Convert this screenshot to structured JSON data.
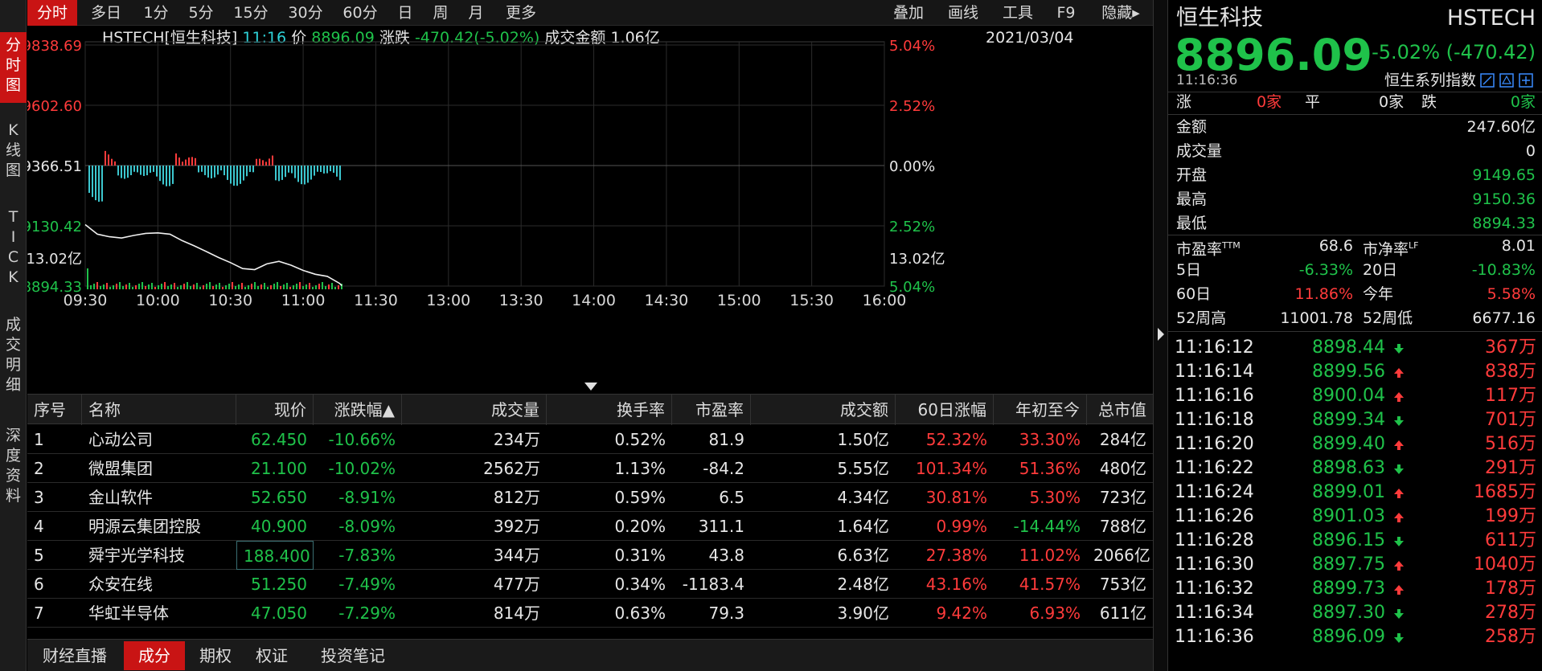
{
  "left_tabs": [
    "分\n时\n图",
    "K\n线\n图",
    "T\nI\nC\nK",
    "成\n交\n明\n细",
    "深\n度\n资\n料"
  ],
  "toolbar": {
    "periods": [
      "分时",
      "多日",
      "1分",
      "5分",
      "15分",
      "30分",
      "60分",
      "日",
      "周",
      "月",
      "更多"
    ],
    "tools": [
      "叠加",
      "画线",
      "工具",
      "F9",
      "隐藏▸"
    ]
  },
  "chart_header": {
    "symbol": "HSTECH[恒生科技]",
    "time": "11:16",
    "price_label": "价",
    "price": "8896.09",
    "change_label": "涨跌",
    "change": "-470.42(-5.02%)",
    "turnover_label": "成交金额",
    "turnover": "1.06亿",
    "date": "2021/03/04"
  },
  "chart_data": {
    "type": "line",
    "title": "",
    "x_ticks": [
      "09:30",
      "10:00",
      "10:30",
      "11:00",
      "11:30",
      "13:00",
      "13:30",
      "14:00",
      "14:30",
      "15:00",
      "15:30",
      "16:00"
    ],
    "y_left_ticks": [
      "9838.69",
      "9602.60",
      "9366.51",
      "9130.42",
      "8894.33"
    ],
    "y_right_ticks": [
      "5.04%",
      "2.52%",
      "0.00%",
      "2.52%",
      "5.04%"
    ],
    "ylim": [
      8894.33,
      9838.69
    ],
    "prev_close": 9366.51,
    "volume_max_label": "13.02亿",
    "volume_max_label_right": "13.02亿",
    "series": [
      {
        "x": [
          "09:30",
          "09:35",
          "09:40",
          "09:45",
          "09:50",
          "09:55",
          "10:00",
          "10:05",
          "10:10",
          "10:15",
          "10:20",
          "10:25",
          "10:30",
          "10:35",
          "10:40",
          "10:45",
          "10:50",
          "10:55",
          "11:00",
          "11:05",
          "11:10",
          "11:15",
          "11:16"
        ],
        "values": [
          9132,
          9095,
          9085,
          9080,
          9090,
          9098,
          9100,
          9095,
          9070,
          9050,
          9028,
          9005,
          8985,
          8962,
          8958,
          8980,
          8990,
          8975,
          8955,
          8940,
          8932,
          8905,
          8896
        ]
      }
    ]
  },
  "table": {
    "columns": [
      "序号",
      "名称",
      "现价",
      "涨跌幅▲",
      "成交量",
      "换手率",
      "市盈率",
      "成交额",
      "60日涨幅",
      "年初至今",
      "总市值"
    ],
    "rows": [
      [
        "1",
        "心动公司",
        "62.450",
        "-10.66%",
        "234万",
        "0.52%",
        "81.9",
        "1.50亿",
        "52.32%",
        "33.30%",
        "284亿"
      ],
      [
        "2",
        "微盟集团",
        "21.100",
        "-10.02%",
        "2562万",
        "1.13%",
        "-84.2",
        "5.55亿",
        "101.34%",
        "51.36%",
        "480亿"
      ],
      [
        "3",
        "金山软件",
        "52.650",
        "-8.91%",
        "812万",
        "0.59%",
        "6.5",
        "4.34亿",
        "30.81%",
        "5.30%",
        "723亿"
      ],
      [
        "4",
        "明源云集团控股",
        "40.900",
        "-8.09%",
        "392万",
        "0.20%",
        "311.1",
        "1.64亿",
        "0.99%",
        "-14.44%",
        "788亿"
      ],
      [
        "5",
        "舜宇光学科技",
        "188.400",
        "-7.83%",
        "344万",
        "0.31%",
        "43.8",
        "6.63亿",
        "27.38%",
        "11.02%",
        "2066亿"
      ],
      [
        "6",
        "众安在线",
        "51.250",
        "-7.49%",
        "477万",
        "0.34%",
        "-1183.4",
        "2.48亿",
        "43.16%",
        "41.57%",
        "753亿"
      ],
      [
        "7",
        "华虹半导体",
        "47.050",
        "-7.29%",
        "814万",
        "0.63%",
        "79.3",
        "3.90亿",
        "9.42%",
        "6.93%",
        "611亿"
      ]
    ]
  },
  "bottom_tabs": [
    "财经直播",
    "成分",
    "期权",
    "权证",
    "投资笔记"
  ],
  "quote": {
    "name": "恒生科技",
    "code": "HSTECH",
    "price": "8896.09",
    "change": "-5.02% (-470.42)",
    "time": "11:16:36",
    "series": "恒生系列指数",
    "up_label": "涨",
    "up_count": "0家",
    "flat_label": "平",
    "flat_count": "0家",
    "down_label": "跌",
    "down_count": "0家",
    "stats": [
      {
        "label": "金额",
        "value": "247.60亿"
      },
      {
        "label": "成交量",
        "value": "0"
      },
      {
        "label": "开盘",
        "value": "9149.65"
      },
      {
        "label": "最高",
        "value": "9150.36"
      },
      {
        "label": "最低",
        "value": "8894.33"
      }
    ],
    "pe_label": "市盈率TTM",
    "pe": "68.6",
    "pb_label": "市净率LF",
    "pb": "8.01",
    "d5_label": "5日",
    "d5": "-6.33%",
    "d20_label": "20日",
    "d20": "-10.83%",
    "d60_label": "60日",
    "d60": "11.86%",
    "ytd_label": "今年",
    "ytd": "5.58%",
    "wk52h_label": "52周高",
    "wk52h": "11001.78",
    "wk52l_label": "52周低",
    "wk52l": "6677.16"
  },
  "ticks": [
    {
      "time": "11:16:12",
      "price": "8898.44",
      "dir": "down",
      "vol": "367万"
    },
    {
      "time": "11:16:14",
      "price": "8899.56",
      "dir": "up",
      "vol": "838万"
    },
    {
      "time": "11:16:16",
      "price": "8900.04",
      "dir": "up",
      "vol": "117万"
    },
    {
      "time": "11:16:18",
      "price": "8899.34",
      "dir": "down",
      "vol": "701万"
    },
    {
      "time": "11:16:20",
      "price": "8899.40",
      "dir": "up",
      "vol": "516万"
    },
    {
      "time": "11:16:22",
      "price": "8898.63",
      "dir": "down",
      "vol": "291万"
    },
    {
      "time": "11:16:24",
      "price": "8899.01",
      "dir": "up",
      "vol": "1685万"
    },
    {
      "time": "11:16:26",
      "price": "8901.03",
      "dir": "up",
      "vol": "199万"
    },
    {
      "time": "11:16:28",
      "price": "8896.15",
      "dir": "down",
      "vol": "611万"
    },
    {
      "time": "11:16:30",
      "price": "8897.75",
      "dir": "up",
      "vol": "1040万"
    },
    {
      "time": "11:16:32",
      "price": "8899.73",
      "dir": "up",
      "vol": "178万"
    },
    {
      "time": "11:16:34",
      "price": "8897.30",
      "dir": "down",
      "vol": "278万"
    },
    {
      "time": "11:16:36",
      "price": "8896.09",
      "dir": "down",
      "vol": "258万"
    }
  ],
  "colors": {
    "up": "#ff3b3b",
    "down": "#1fc24a",
    "accent": "#c91414",
    "time": "#2ed3d9"
  }
}
